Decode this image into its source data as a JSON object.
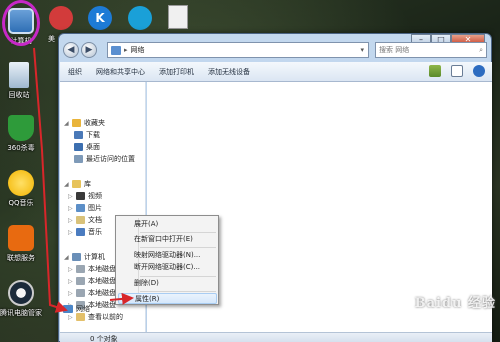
{
  "desktop": {
    "icons": [
      {
        "label": "计算机",
        "color": "#2f6fb5"
      },
      {
        "label": "回收站",
        "color": "#7fa6c8"
      },
      {
        "label": "360杀毒",
        "color": "#2e9b3a"
      },
      {
        "label": "QQ音乐",
        "color": "#f2b400"
      },
      {
        "label": "联想服务",
        "color": "#e86a10"
      },
      {
        "label": "腾讯电脑管家",
        "color": "#1b2a3a"
      }
    ],
    "top_icons": [
      {
        "color": "#d23b3b"
      },
      {
        "color": "#1d7bd6"
      },
      {
        "color": "#1aa0d8"
      },
      {
        "color": "#e6e6e6"
      }
    ],
    "partial_label": "美"
  },
  "window": {
    "address": "网络",
    "search_placeholder": "搜索 网络",
    "toolbar": [
      "组织",
      "网络和共享中心",
      "添加打印机",
      "添加无线设备"
    ],
    "nav": {
      "favorites": "收藏夹",
      "fav_items": [
        "下载",
        "桌面",
        "最近访问的位置"
      ],
      "libraries": "库",
      "lib_items": [
        "视频",
        "图片",
        "文档",
        "音乐"
      ],
      "computer": "计算机",
      "computer_items": [
        "本地磁盘",
        "本地磁盘",
        "本地磁盘",
        "本地磁盘",
        "查看以前的"
      ],
      "network": "网络"
    },
    "status": "0 个对象"
  },
  "context_menu": {
    "items": [
      "展开(A)",
      "在新窗口中打开(E)",
      "映射网络驱动器(N)...",
      "断开网络驱动器(C)...",
      "删除(D)",
      "属性(R)"
    ],
    "highlighted_index": 5
  },
  "watermark": "Baidu 经验",
  "colors": {
    "annotation": "#c728c7",
    "arrow": "#d8262a"
  }
}
